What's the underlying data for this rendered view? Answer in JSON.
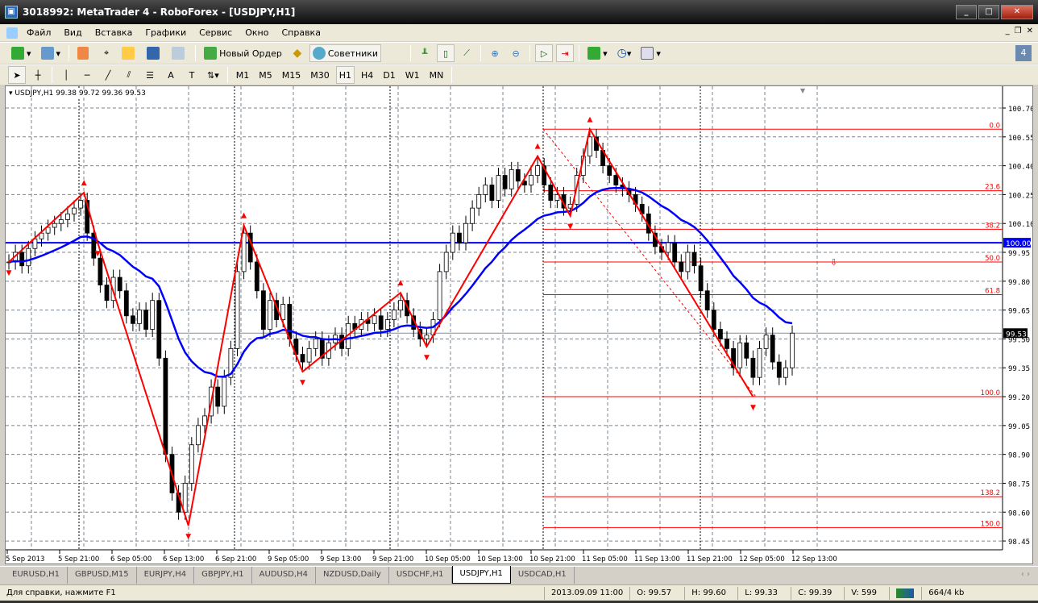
{
  "window": {
    "title": "3018992: MetaTrader 4 - RoboForex - [USDJPY,H1]",
    "buttons": [
      "minimize",
      "maximize",
      "close"
    ]
  },
  "menu": [
    "Файл",
    "Вид",
    "Вставка",
    "Графики",
    "Сервис",
    "Окно",
    "Справка"
  ],
  "toolbar1": {
    "new_order": "Новый Ордер",
    "experts": "Советники"
  },
  "toolbar2": {
    "timeframes": [
      "M1",
      "M5",
      "M15",
      "M30",
      "H1",
      "H4",
      "D1",
      "W1",
      "MN"
    ],
    "active_timeframe": "H1"
  },
  "chart": {
    "header": "USDJPY,H1  99.38 99.72 99.36 99.53",
    "current_price": "99.53",
    "hline_price": "100.00",
    "colors": {
      "bull": "#ffffff",
      "bear": "#000000",
      "ma": "#0000ff",
      "zigzag": "#ff0000",
      "fib": "#ff0000",
      "hline": "#0000ff"
    }
  },
  "chart_data": {
    "type": "candlestick",
    "symbol": "USDJPY",
    "timeframe": "H1",
    "ylim": [
      98.4,
      100.78
    ],
    "yticks": [
      "100.70",
      "100.55",
      "100.40",
      "100.25",
      "100.10",
      "99.95",
      "99.80",
      "99.65",
      "99.50",
      "99.35",
      "99.20",
      "99.05",
      "98.90",
      "98.75",
      "98.60",
      "98.45"
    ],
    "xticks": [
      "5 Sep 2013",
      "5 Sep 21:00",
      "6 Sep 05:00",
      "6 Sep 13:00",
      "6 Sep 21:00",
      "9 Sep 05:00",
      "9 Sep 13:00",
      "9 Sep 21:00",
      "10 Sep 05:00",
      "10 Sep 13:00",
      "10 Sep 21:00",
      "11 Sep 05:00",
      "11 Sep 13:00",
      "11 Sep 21:00",
      "12 Sep 05:00",
      "12 Sep 13:00"
    ],
    "close": [
      99.9,
      99.95,
      99.88,
      99.97,
      100.02,
      100.05,
      100.08,
      100.1,
      100.12,
      100.15,
      100.18,
      100.22,
      100.05,
      99.92,
      99.78,
      99.7,
      99.82,
      99.75,
      99.62,
      99.58,
      99.65,
      99.55,
      99.7,
      99.4,
      98.9,
      98.7,
      98.6,
      98.75,
      98.95,
      99.05,
      99.1,
      99.25,
      99.15,
      99.3,
      99.45,
      99.85,
      100.05,
      99.9,
      99.75,
      99.55,
      99.7,
      99.6,
      99.68,
      99.5,
      99.42,
      99.38,
      99.45,
      99.5,
      99.4,
      99.48,
      99.52,
      99.45,
      99.58,
      99.55,
      99.6,
      99.58,
      99.62,
      99.55,
      99.6,
      99.65,
      99.7,
      99.62,
      99.55,
      99.5,
      99.52,
      99.6,
      99.85,
      99.95,
      100.05,
      100.0,
      100.1,
      100.18,
      100.25,
      100.3,
      100.22,
      100.35,
      100.28,
      100.38,
      100.32,
      100.3,
      100.35,
      100.4,
      100.3,
      100.22,
      100.25,
      100.18,
      100.2,
      100.35,
      100.45,
      100.55,
      100.48,
      100.4,
      100.35,
      100.3,
      100.28,
      100.25,
      100.2,
      100.15,
      100.05,
      99.98,
      99.95,
      100.0,
      99.9,
      99.85,
      99.95,
      99.88,
      99.75,
      99.65,
      99.55,
      99.5,
      99.45,
      99.35,
      99.48,
      99.4,
      99.3,
      99.45,
      99.52,
      99.38,
      99.3,
      99.35,
      99.53
    ],
    "zigzag": [
      [
        0,
        99.9
      ],
      [
        11.5,
        100.26
      ],
      [
        13.6,
        100.0
      ],
      [
        27.5,
        98.53
      ],
      [
        36,
        100.09
      ],
      [
        45,
        99.33
      ],
      [
        60,
        99.74
      ],
      [
        64,
        99.46
      ],
      [
        81,
        100.45
      ],
      [
        86,
        100.14
      ],
      [
        89,
        100.59
      ],
      [
        114,
        99.2
      ]
    ],
    "fibonacci": [
      {
        "label": "0.0",
        "price": 100.59
      },
      {
        "label": "23.6",
        "price": 100.27
      },
      {
        "label": "38.2",
        "price": 100.07
      },
      {
        "label": "50.0",
        "price": 99.9
      },
      {
        "label": "61.8",
        "price": 99.73
      },
      {
        "label": "100.0",
        "price": 99.2
      },
      {
        "label": "138.2",
        "price": 98.68
      },
      {
        "label": "150.0",
        "price": 98.52
      }
    ]
  },
  "tabs": [
    "EURUSD,H1",
    "GBPUSD,M15",
    "EURJPY,H4",
    "GBPJPY,H1",
    "AUDUSD,H4",
    "NZDUSD,Daily",
    "USDCHF,H1",
    "USDJPY,H1",
    "USDCAD,H1"
  ],
  "active_tab": "USDJPY,H1",
  "status": {
    "help": "Для справки, нажмите F1",
    "datetime": "2013.09.09 11:00",
    "open": "O: 99.57",
    "high": "H: 99.60",
    "low": "L: 99.33",
    "close": "C: 99.39",
    "volume": "V: 599",
    "traffic": "664/4 kb"
  }
}
